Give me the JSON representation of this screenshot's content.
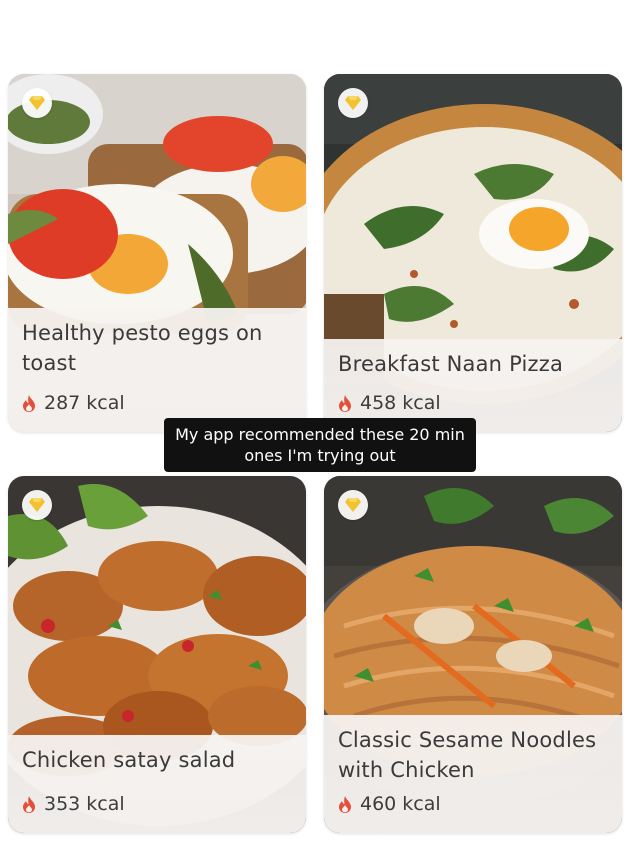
{
  "recipes": [
    {
      "title": "Healthy pesto eggs on toast",
      "kcal": "287 kcal",
      "badge_icon": "diamond-icon",
      "kcal_icon": "flame-icon"
    },
    {
      "title": "Breakfast Naan Pizza",
      "kcal": "458 kcal",
      "badge_icon": "diamond-icon",
      "kcal_icon": "flame-icon"
    },
    {
      "title": "Chicken satay salad",
      "kcal": "353 kcal",
      "badge_icon": "diamond-icon",
      "kcal_icon": "flame-icon"
    },
    {
      "title": "Classic Sesame Noodles with Chicken",
      "kcal": "460 kcal",
      "badge_icon": "diamond-icon",
      "kcal_icon": "flame-icon"
    }
  ],
  "caption": "My app recommended these 20 min ones I'm trying out",
  "colors": {
    "flame": "#e2503a",
    "badge_diamond": "#f2c230",
    "card_bg": "#f4f1ef",
    "caption_bg": "#111111"
  }
}
